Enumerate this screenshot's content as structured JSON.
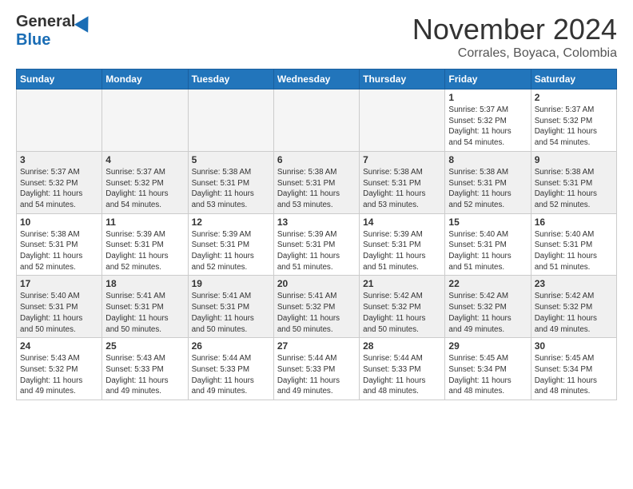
{
  "logo": {
    "general": "General",
    "blue": "Blue"
  },
  "header": {
    "month": "November 2024",
    "location": "Corrales, Boyaca, Colombia"
  },
  "weekdays": [
    "Sunday",
    "Monday",
    "Tuesday",
    "Wednesday",
    "Thursday",
    "Friday",
    "Saturday"
  ],
  "weeks": [
    [
      {
        "day": "",
        "sunrise": "",
        "sunset": "",
        "daylight": "",
        "empty": true
      },
      {
        "day": "",
        "sunrise": "",
        "sunset": "",
        "daylight": "",
        "empty": true
      },
      {
        "day": "",
        "sunrise": "",
        "sunset": "",
        "daylight": "",
        "empty": true
      },
      {
        "day": "",
        "sunrise": "",
        "sunset": "",
        "daylight": "",
        "empty": true
      },
      {
        "day": "",
        "sunrise": "",
        "sunset": "",
        "daylight": "",
        "empty": true
      },
      {
        "day": "1",
        "sunrise": "Sunrise: 5:37 AM",
        "sunset": "Sunset: 5:32 PM",
        "daylight": "Daylight: 11 hours and 54 minutes."
      },
      {
        "day": "2",
        "sunrise": "Sunrise: 5:37 AM",
        "sunset": "Sunset: 5:32 PM",
        "daylight": "Daylight: 11 hours and 54 minutes."
      }
    ],
    [
      {
        "day": "3",
        "sunrise": "Sunrise: 5:37 AM",
        "sunset": "Sunset: 5:32 PM",
        "daylight": "Daylight: 11 hours and 54 minutes."
      },
      {
        "day": "4",
        "sunrise": "Sunrise: 5:37 AM",
        "sunset": "Sunset: 5:32 PM",
        "daylight": "Daylight: 11 hours and 54 minutes."
      },
      {
        "day": "5",
        "sunrise": "Sunrise: 5:38 AM",
        "sunset": "Sunset: 5:31 PM",
        "daylight": "Daylight: 11 hours and 53 minutes."
      },
      {
        "day": "6",
        "sunrise": "Sunrise: 5:38 AM",
        "sunset": "Sunset: 5:31 PM",
        "daylight": "Daylight: 11 hours and 53 minutes."
      },
      {
        "day": "7",
        "sunrise": "Sunrise: 5:38 AM",
        "sunset": "Sunset: 5:31 PM",
        "daylight": "Daylight: 11 hours and 53 minutes."
      },
      {
        "day": "8",
        "sunrise": "Sunrise: 5:38 AM",
        "sunset": "Sunset: 5:31 PM",
        "daylight": "Daylight: 11 hours and 52 minutes."
      },
      {
        "day": "9",
        "sunrise": "Sunrise: 5:38 AM",
        "sunset": "Sunset: 5:31 PM",
        "daylight": "Daylight: 11 hours and 52 minutes."
      }
    ],
    [
      {
        "day": "10",
        "sunrise": "Sunrise: 5:38 AM",
        "sunset": "Sunset: 5:31 PM",
        "daylight": "Daylight: 11 hours and 52 minutes."
      },
      {
        "day": "11",
        "sunrise": "Sunrise: 5:39 AM",
        "sunset": "Sunset: 5:31 PM",
        "daylight": "Daylight: 11 hours and 52 minutes."
      },
      {
        "day": "12",
        "sunrise": "Sunrise: 5:39 AM",
        "sunset": "Sunset: 5:31 PM",
        "daylight": "Daylight: 11 hours and 52 minutes."
      },
      {
        "day": "13",
        "sunrise": "Sunrise: 5:39 AM",
        "sunset": "Sunset: 5:31 PM",
        "daylight": "Daylight: 11 hours and 51 minutes."
      },
      {
        "day": "14",
        "sunrise": "Sunrise: 5:39 AM",
        "sunset": "Sunset: 5:31 PM",
        "daylight": "Daylight: 11 hours and 51 minutes."
      },
      {
        "day": "15",
        "sunrise": "Sunrise: 5:40 AM",
        "sunset": "Sunset: 5:31 PM",
        "daylight": "Daylight: 11 hours and 51 minutes."
      },
      {
        "day": "16",
        "sunrise": "Sunrise: 5:40 AM",
        "sunset": "Sunset: 5:31 PM",
        "daylight": "Daylight: 11 hours and 51 minutes."
      }
    ],
    [
      {
        "day": "17",
        "sunrise": "Sunrise: 5:40 AM",
        "sunset": "Sunset: 5:31 PM",
        "daylight": "Daylight: 11 hours and 50 minutes."
      },
      {
        "day": "18",
        "sunrise": "Sunrise: 5:41 AM",
        "sunset": "Sunset: 5:31 PM",
        "daylight": "Daylight: 11 hours and 50 minutes."
      },
      {
        "day": "19",
        "sunrise": "Sunrise: 5:41 AM",
        "sunset": "Sunset: 5:31 PM",
        "daylight": "Daylight: 11 hours and 50 minutes."
      },
      {
        "day": "20",
        "sunrise": "Sunrise: 5:41 AM",
        "sunset": "Sunset: 5:32 PM",
        "daylight": "Daylight: 11 hours and 50 minutes."
      },
      {
        "day": "21",
        "sunrise": "Sunrise: 5:42 AM",
        "sunset": "Sunset: 5:32 PM",
        "daylight": "Daylight: 11 hours and 50 minutes."
      },
      {
        "day": "22",
        "sunrise": "Sunrise: 5:42 AM",
        "sunset": "Sunset: 5:32 PM",
        "daylight": "Daylight: 11 hours and 49 minutes."
      },
      {
        "day": "23",
        "sunrise": "Sunrise: 5:42 AM",
        "sunset": "Sunset: 5:32 PM",
        "daylight": "Daylight: 11 hours and 49 minutes."
      }
    ],
    [
      {
        "day": "24",
        "sunrise": "Sunrise: 5:43 AM",
        "sunset": "Sunset: 5:32 PM",
        "daylight": "Daylight: 11 hours and 49 minutes."
      },
      {
        "day": "25",
        "sunrise": "Sunrise: 5:43 AM",
        "sunset": "Sunset: 5:33 PM",
        "daylight": "Daylight: 11 hours and 49 minutes."
      },
      {
        "day": "26",
        "sunrise": "Sunrise: 5:44 AM",
        "sunset": "Sunset: 5:33 PM",
        "daylight": "Daylight: 11 hours and 49 minutes."
      },
      {
        "day": "27",
        "sunrise": "Sunrise: 5:44 AM",
        "sunset": "Sunset: 5:33 PM",
        "daylight": "Daylight: 11 hours and 49 minutes."
      },
      {
        "day": "28",
        "sunrise": "Sunrise: 5:44 AM",
        "sunset": "Sunset: 5:33 PM",
        "daylight": "Daylight: 11 hours and 48 minutes."
      },
      {
        "day": "29",
        "sunrise": "Sunrise: 5:45 AM",
        "sunset": "Sunset: 5:34 PM",
        "daylight": "Daylight: 11 hours and 48 minutes."
      },
      {
        "day": "30",
        "sunrise": "Sunrise: 5:45 AM",
        "sunset": "Sunset: 5:34 PM",
        "daylight": "Daylight: 11 hours and 48 minutes."
      }
    ]
  ]
}
